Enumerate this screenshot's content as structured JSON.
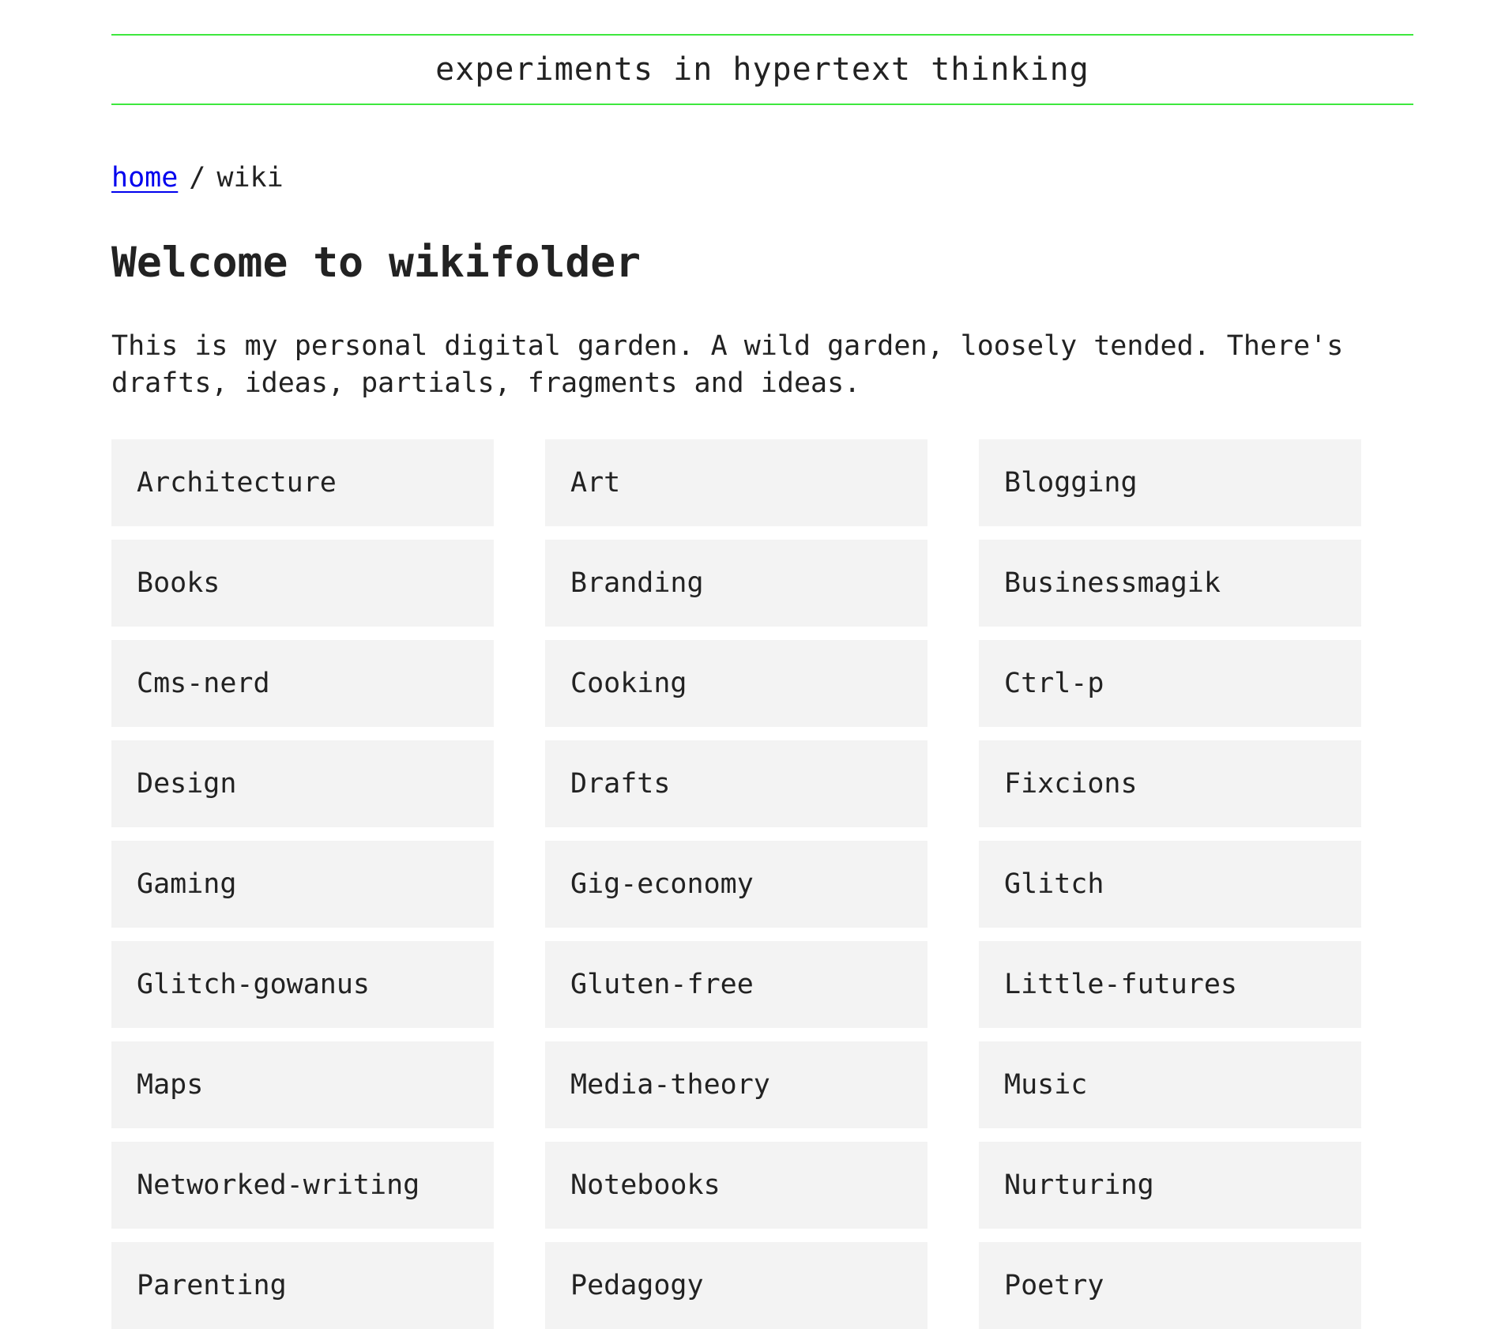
{
  "header": {
    "site_title": "experiments in hypertext thinking"
  },
  "breadcrumb": {
    "home_label": "home",
    "separator": "/",
    "current": "wiki"
  },
  "page": {
    "title": "Welcome to wikifolder",
    "intro": "This is my personal digital garden. A wild garden, loosely tended. There's drafts, ideas, partials, fragments and ideas."
  },
  "categories": [
    "Architecture",
    "Art",
    "Blogging",
    "Books",
    "Branding",
    "Businessmagik",
    "Cms-nerd",
    "Cooking",
    "Ctrl-p",
    "Design",
    "Drafts",
    "Fixcions",
    "Gaming",
    "Gig-economy",
    "Glitch",
    "Glitch-gowanus",
    "Gluten-free",
    "Little-futures",
    "Maps",
    "Media-theory",
    "Music",
    "Networked-writing",
    "Notebooks",
    "Nurturing",
    "Parenting",
    "Pedagogy",
    "Poetry"
  ],
  "colors": {
    "header_rule": "#3ee83e",
    "link": "#0000ee",
    "tile_background": "#f3f3f3",
    "text": "#222222"
  }
}
